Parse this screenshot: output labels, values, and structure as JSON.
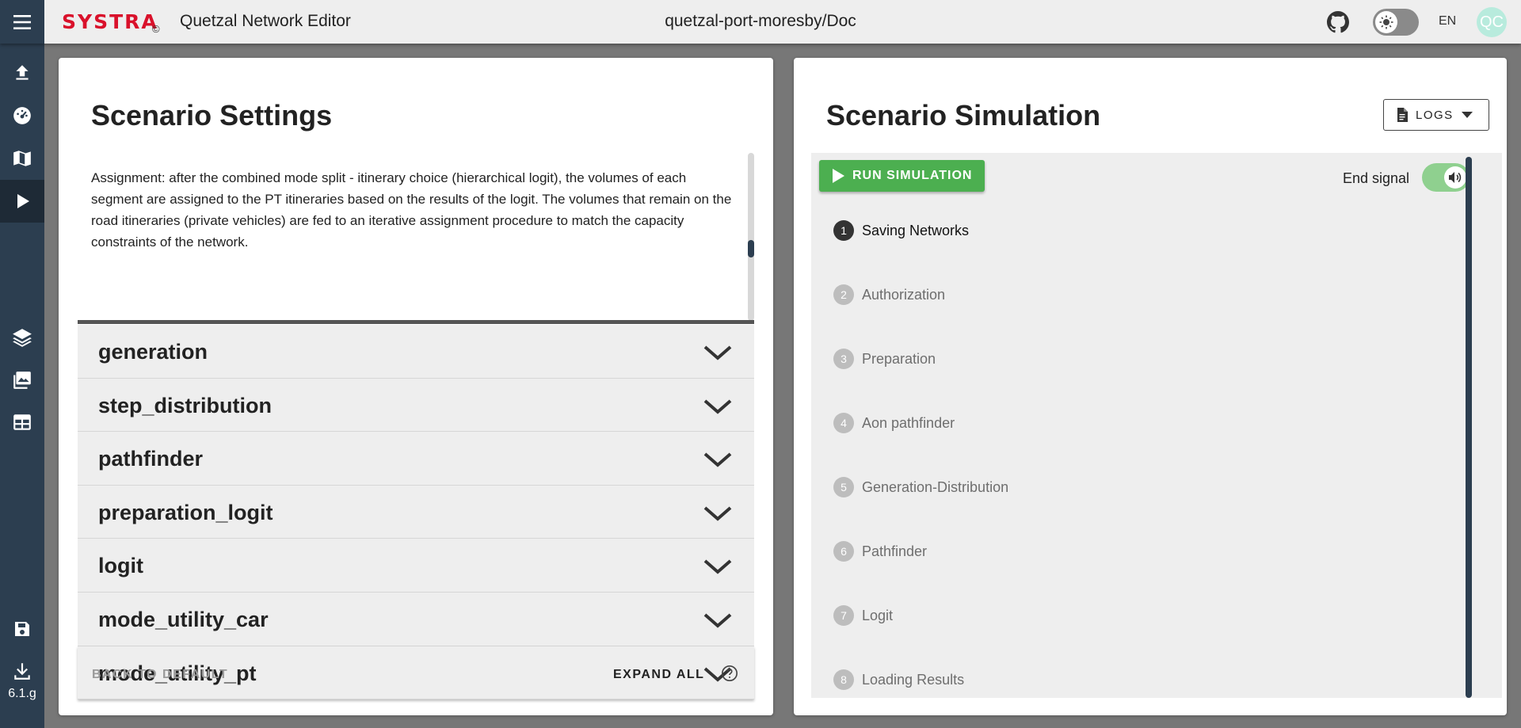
{
  "header": {
    "logo_text": "SYSTRA",
    "logo_mark": "©",
    "app_title": "Quetzal Network Editor",
    "project_title": "quetzal-port-moresby/Doc",
    "language": "EN",
    "avatar_initials": "QC"
  },
  "sidebar": {
    "items": [
      {
        "icon": "upload-icon"
      },
      {
        "icon": "dashboard-icon"
      },
      {
        "icon": "map-icon"
      },
      {
        "icon": "run-icon",
        "active": true
      },
      {
        "icon": "layers-icon"
      },
      {
        "icon": "gallery-icon"
      },
      {
        "icon": "table-icon"
      },
      {
        "icon": "save-icon"
      },
      {
        "icon": "download-icon"
      }
    ],
    "version": "6.1.g"
  },
  "settings": {
    "title": "Scenario Settings",
    "description": "Assignment: after the combined mode split - itinerary choice (hierarchical logit), the volumes of each segment are assigned to the PT itineraries based on the results of the logit. The volumes that remain on the road itineraries (private vehicles) are fed to an iterative assignment procedure to match the capacity constraints of the network.",
    "sections": [
      "generation",
      "step_distribution",
      "pathfinder",
      "preparation_logit",
      "logit",
      "mode_utility_car",
      "mode_utility_pt"
    ],
    "back_to_default": "BACK TO DEFAULT",
    "expand_all": "EXPAND ALL"
  },
  "simulation": {
    "title": "Scenario Simulation",
    "logs_label": "LOGS",
    "run_label": "RUN SIMULATION",
    "end_signal_label": "End signal",
    "end_signal_on": true,
    "steps": [
      {
        "num": "1",
        "label": "Saving Networks",
        "active": true
      },
      {
        "num": "2",
        "label": "Authorization"
      },
      {
        "num": "3",
        "label": "Preparation"
      },
      {
        "num": "4",
        "label": "Aon pathfinder"
      },
      {
        "num": "5",
        "label": "Generation-Distribution"
      },
      {
        "num": "6",
        "label": "Pathfinder"
      },
      {
        "num": "7",
        "label": "Logit"
      },
      {
        "num": "8",
        "label": "Loading Results"
      }
    ]
  },
  "colors": {
    "sidebar": "#2c3e50",
    "brand": "#d9112b",
    "run_button": "#4caf50",
    "toggle_on": "#8fd08f"
  }
}
